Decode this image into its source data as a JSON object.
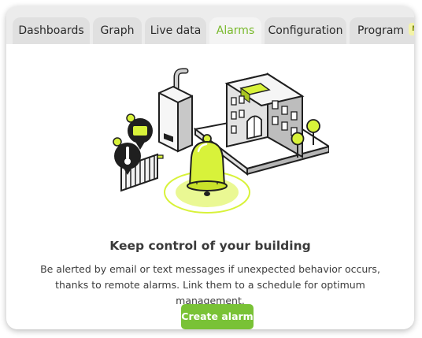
{
  "tabs": [
    {
      "label": "Dashboards"
    },
    {
      "label": "Graph"
    },
    {
      "label": "Live data"
    },
    {
      "label": "Alarms"
    },
    {
      "label": "Configuration"
    },
    {
      "label": "Program",
      "badge": "NE"
    }
  ],
  "active_tab": "Alarms",
  "main": {
    "headline": "Keep control of your building",
    "description": "Be alerted by email or text messages if unexpected behavior occurs, thanks to remote alarms. Link them to a schedule for optimum management.",
    "cta_label": "Create alarm"
  },
  "colors": {
    "accent": "#79c236",
    "active_tab_text": "#79b92c",
    "illustration_highlight": "#d8f23a"
  }
}
